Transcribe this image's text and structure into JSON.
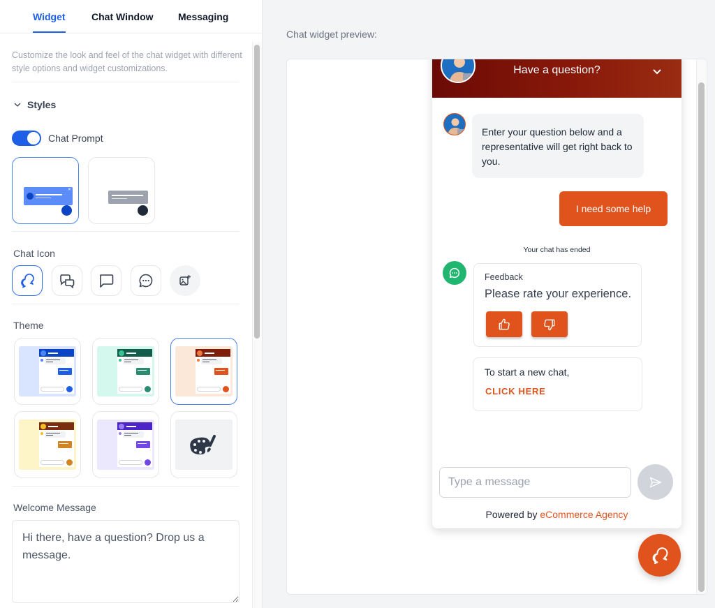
{
  "tabs": [
    {
      "label": "Widget",
      "active": true
    },
    {
      "label": "Chat Window",
      "active": false
    },
    {
      "label": "Messaging",
      "active": false
    }
  ],
  "widget_settings": {
    "description": "Customize the look and feel of the chat widget with different style options and widget customizations.",
    "styles_section": "Styles",
    "chat_prompt": {
      "label": "Chat Prompt",
      "enabled": true
    },
    "prompt_styles": [
      {
        "name": "blue",
        "selected": true,
        "bar_color": "#5b8cf7",
        "dot_color": "#0b44c4"
      },
      {
        "name": "gray",
        "selected": false,
        "bar_color": "#9ca3af",
        "dot_color": "#1f2937"
      }
    ],
    "chat_icon_label": "Chat Icon",
    "chat_icons": [
      {
        "icon": "chat-bubbles-overlap-icon",
        "selected": true
      },
      {
        "icon": "chat-bubbles-square-icon",
        "selected": false
      },
      {
        "icon": "chat-bubble-square-icon",
        "selected": false
      },
      {
        "icon": "chat-bubble-dots-icon",
        "selected": false
      },
      {
        "icon": "upload-image-icon",
        "selected": false
      }
    ],
    "theme_label": "Theme",
    "themes": [
      {
        "name": "blue",
        "bg": "#d9e5fe",
        "head": "#0b44c4",
        "accent": "#1d5fe6",
        "avatar": "#4f86f7",
        "selected": false
      },
      {
        "name": "green",
        "bg": "#d5f8ee",
        "head": "#145c4c",
        "accent": "#2a8c6e",
        "avatar": "#3bc492",
        "selected": false
      },
      {
        "name": "orange",
        "bg": "#fbe8d8",
        "head": "#7d1f0c",
        "accent": "#e0531d",
        "avatar": "#f07a3e",
        "selected": true
      },
      {
        "name": "yellow",
        "bg": "#fdf4c7",
        "head": "#7a2d10",
        "accent": "#d18423",
        "avatar": "#f5be20",
        "selected": false
      },
      {
        "name": "purple",
        "bg": "#ebe7fd",
        "head": "#4c22c9",
        "accent": "#7148e6",
        "avatar": "#9a7ff0",
        "selected": false
      },
      {
        "name": "custom",
        "icon": "palette-icon",
        "selected": false
      }
    ],
    "welcome_label": "Welcome Message",
    "welcome_message": "Hi there, have a question? Drop us a message."
  },
  "preview": {
    "label": "Chat widget preview:",
    "header_title": "Have a question?",
    "agent_message": "Enter your question below and a representative will get right back to you.",
    "user_message": "I need some help",
    "status": "Your chat has ended",
    "feedback": {
      "title": "Feedback",
      "prompt": "Please rate your experience."
    },
    "new_chat": {
      "text": "To start a new chat,",
      "link": "CLICK HERE"
    },
    "input_placeholder": "Type a message",
    "powered_by": "Powered by",
    "brand": "eCommerce Agency",
    "accent_color": "#e0531d"
  }
}
